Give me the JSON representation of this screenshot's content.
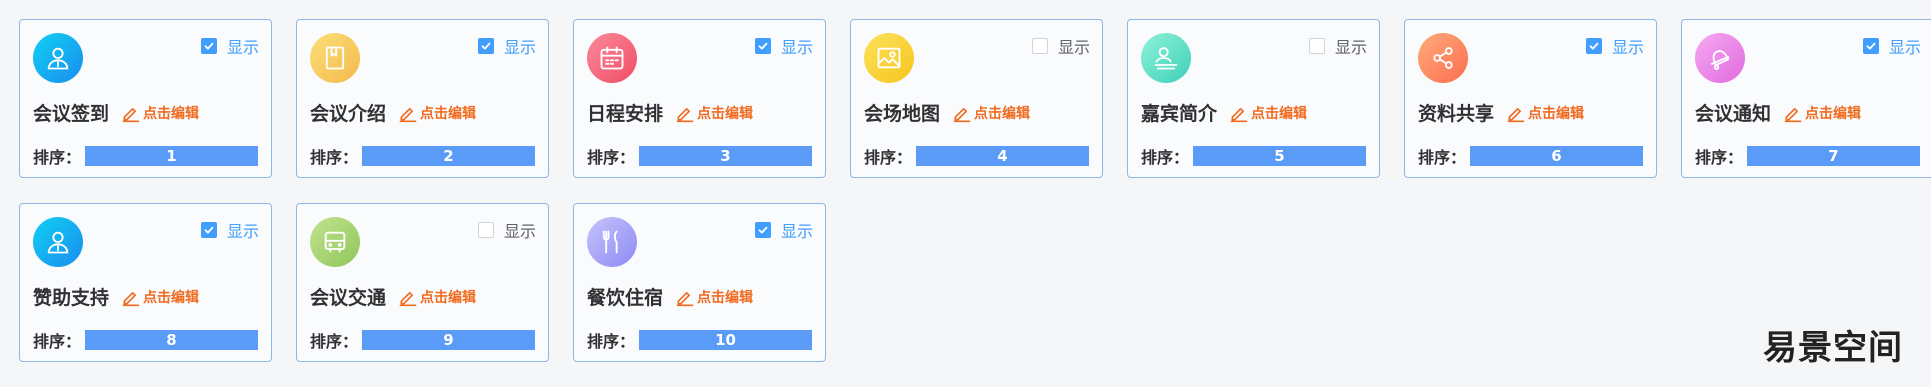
{
  "cards": [
    {
      "title": "会议签到",
      "show_label": "显示",
      "checked": true,
      "edit_label": "点击编辑",
      "sort_label": "排序：",
      "order": "1",
      "icon": "user-badge-icon",
      "grad": [
        "#10d0f2",
        "#1a8df0"
      ]
    },
    {
      "title": "会议介绍",
      "show_label": "显示",
      "checked": true,
      "edit_label": "点击编辑",
      "sort_label": "排序：",
      "order": "2",
      "icon": "book-icon",
      "grad": [
        "#fbe07a",
        "#f4b94a"
      ]
    },
    {
      "title": "日程安排",
      "show_label": "显示",
      "checked": true,
      "edit_label": "点击编辑",
      "sort_label": "排序：",
      "order": "3",
      "icon": "calendar-icon",
      "grad": [
        "#fb8a9b",
        "#ef4d66"
      ]
    },
    {
      "title": "会场地图",
      "show_label": "显示",
      "checked": false,
      "edit_label": "点击编辑",
      "sort_label": "排序：",
      "order": "4",
      "icon": "map-icon",
      "grad": [
        "#fde25d",
        "#f6c51c"
      ]
    },
    {
      "title": "嘉宾简介",
      "show_label": "显示",
      "checked": false,
      "edit_label": "点击编辑",
      "sort_label": "排序：",
      "order": "5",
      "icon": "guest-icon",
      "grad": [
        "#8ef2da",
        "#3ed0b6"
      ]
    },
    {
      "title": "资料共享",
      "show_label": "显示",
      "checked": true,
      "edit_label": "点击编辑",
      "sort_label": "排序：",
      "order": "6",
      "icon": "share-icon",
      "grad": [
        "#ffab7c",
        "#fb6e4e"
      ]
    },
    {
      "title": "会议通知",
      "show_label": "显示",
      "checked": true,
      "edit_label": "点击编辑",
      "sort_label": "排序：",
      "order": "7",
      "icon": "bell-icon",
      "grad": [
        "#f6a9f2",
        "#e16adf"
      ]
    },
    {
      "title": "赞助支持",
      "show_label": "显示",
      "checked": true,
      "edit_label": "点击编辑",
      "sort_label": "排序：",
      "order": "8",
      "icon": "user-badge-icon",
      "grad": [
        "#10d0f2",
        "#1a8df0"
      ]
    },
    {
      "title": "会议交通",
      "show_label": "显示",
      "checked": false,
      "edit_label": "点击编辑",
      "sort_label": "排序：",
      "order": "9",
      "icon": "bus-icon",
      "grad": [
        "#c3e38e",
        "#8fc65b"
      ]
    },
    {
      "title": "餐饮住宿",
      "show_label": "显示",
      "checked": true,
      "edit_label": "点击编辑",
      "sort_label": "排序：",
      "order": "10",
      "icon": "utensils-icon",
      "grad": [
        "#c6c2fb",
        "#8d8cf4"
      ]
    }
  ],
  "watermark": "易景空间",
  "colors": {
    "checked": "#409eff",
    "bar": "#5b9bf8",
    "edit": "#f06b1f",
    "border": "#8fb6e6"
  }
}
